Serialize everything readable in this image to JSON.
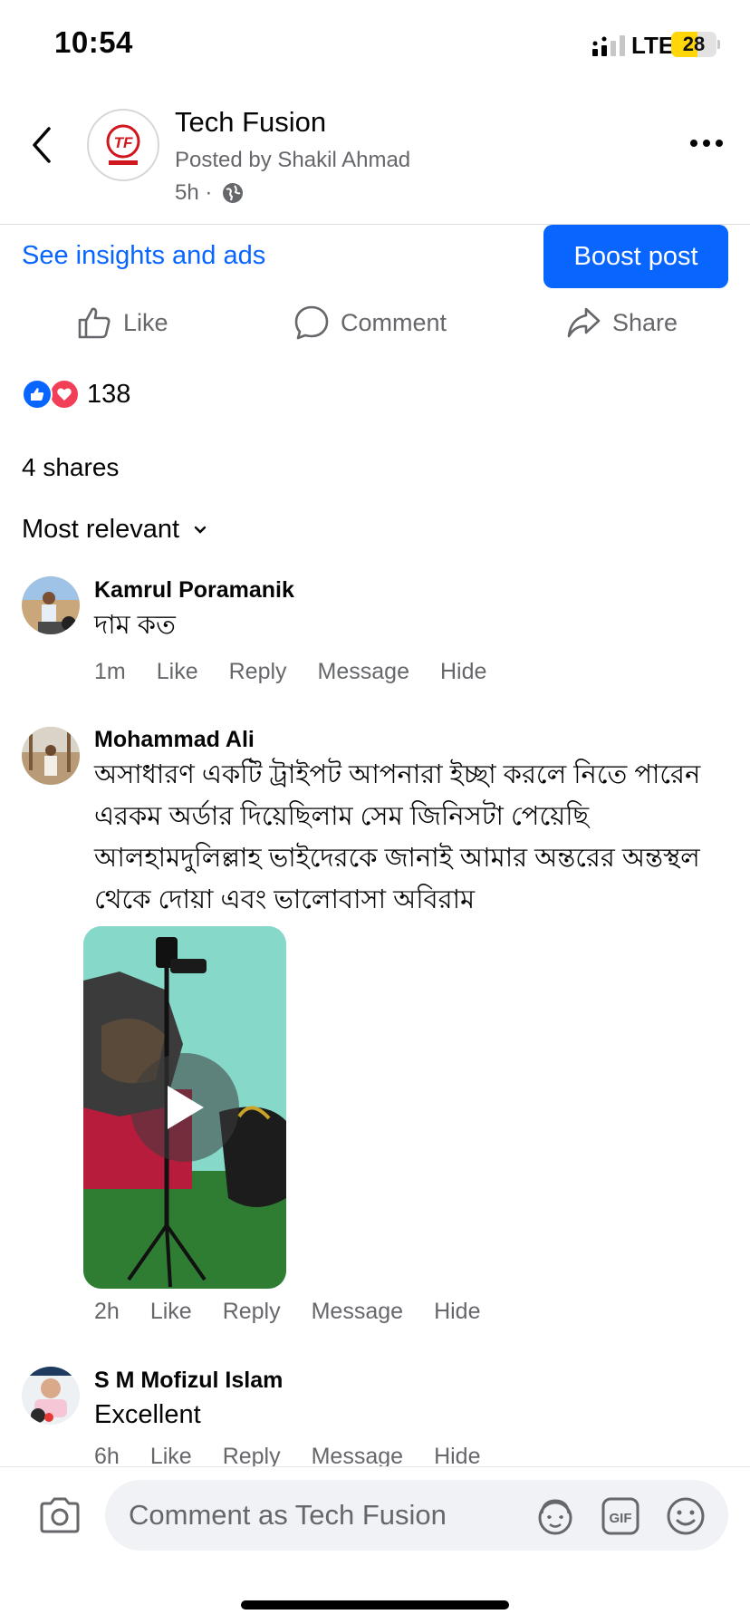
{
  "status_bar": {
    "time": "10:54",
    "network": "LTE",
    "battery": "28"
  },
  "header": {
    "page_name": "Tech Fusion",
    "posted_by": "Posted by Shakil Ahmad",
    "time": "5h ·",
    "logo_text": "TF"
  },
  "insights_link": "See insights and ads",
  "boost_button": "Boost post",
  "actions": {
    "like": "Like",
    "comment": "Comment",
    "share": "Share"
  },
  "reactions": {
    "count": "138"
  },
  "shares": "4 shares",
  "sort": "Most relevant",
  "comments": [
    {
      "name": "Kamrul Poramanik",
      "text": "দাম কত",
      "time": "1m",
      "like": "Like",
      "reply": "Reply",
      "message": "Message",
      "hide": "Hide"
    },
    {
      "name": "Mohammad Ali",
      "text": "অসাধারণ একটি ট্রাইপট আপনারা ইচ্ছা করলে নিতে পারেন এরকম অর্ডার দিয়েছিলাম সেম জিনিসটা পেয়েছি আলহামদুলিল্লাহ ভাইদেরকে জানাই আমার অন্তরের অন্তস্থল থেকে দোয়া এবং ভালোবাসা অবিরাম",
      "time": "2h",
      "like": "Like",
      "reply": "Reply",
      "message": "Message",
      "hide": "Hide"
    },
    {
      "name": "S M Mofizul Islam",
      "text": "Excellent",
      "time": "6h",
      "like": "Like",
      "reply": "Reply",
      "message": "Message",
      "hide": "Hide"
    }
  ],
  "composer": {
    "placeholder": "Comment as Tech Fusion"
  },
  "colors": {
    "accent": "#0866ff",
    "secondary_text": "#65676b",
    "love": "#f33e58"
  }
}
